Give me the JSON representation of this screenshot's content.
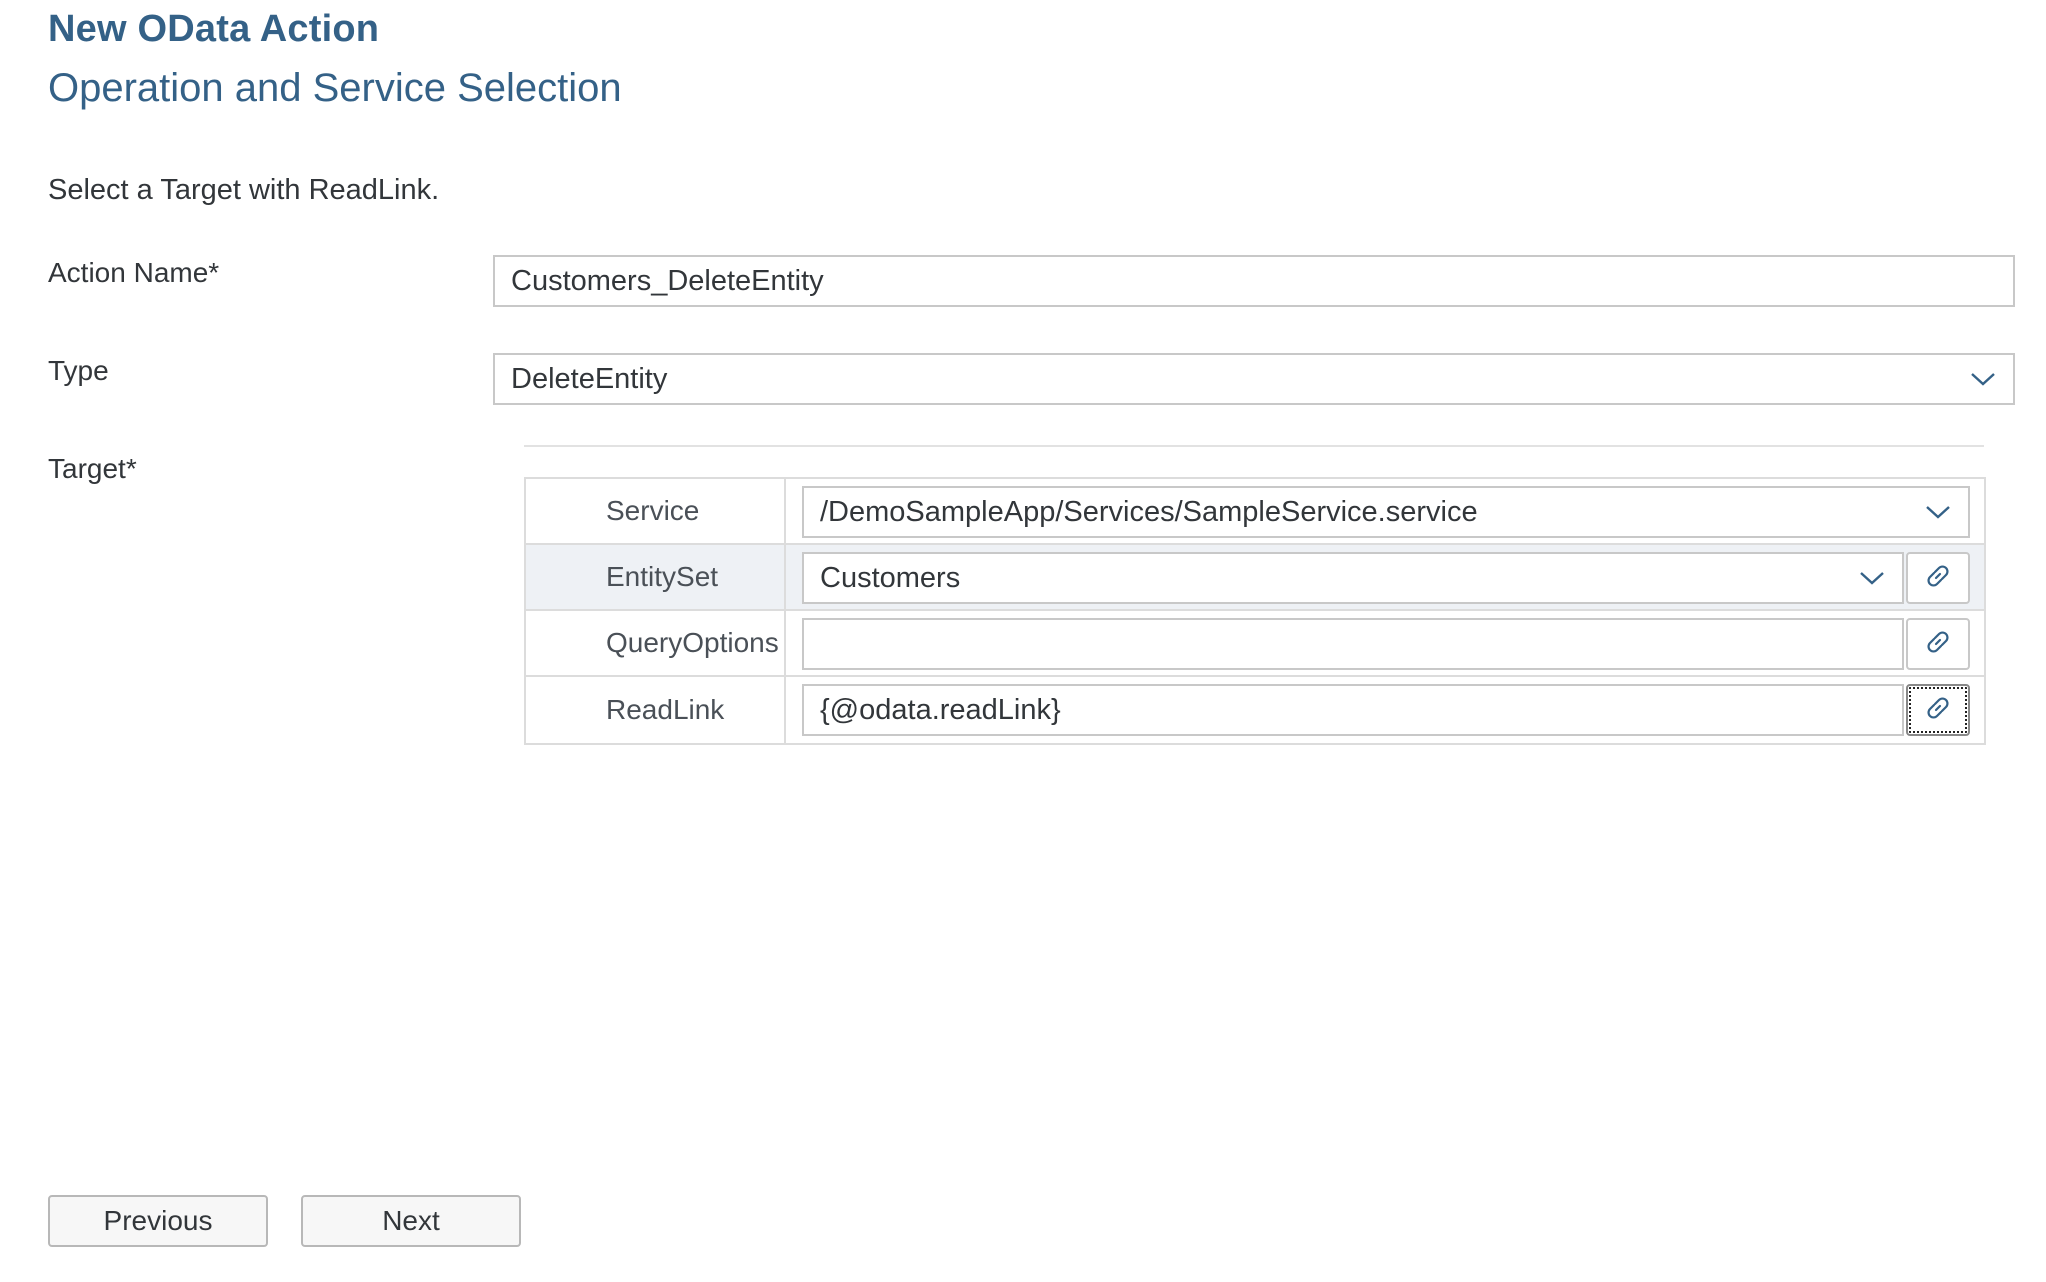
{
  "header": {
    "title": "New OData Action",
    "subtitle": "Operation and Service Selection"
  },
  "instruction": "Select a Target with ReadLink.",
  "form": {
    "action_name": {
      "label": "Action Name*",
      "value": "Customers_DeleteEntity"
    },
    "type": {
      "label": "Type",
      "value": "DeleteEntity"
    },
    "target": {
      "label": "Target*",
      "rows": [
        {
          "label": "Service",
          "value": "/DemoSampleApp/Services/SampleService.service",
          "control": "select"
        },
        {
          "label": "EntitySet",
          "value": "Customers",
          "control": "select"
        },
        {
          "label": "QueryOptions",
          "value": "",
          "control": "input"
        },
        {
          "label": "ReadLink",
          "value": "{@odata.readLink}",
          "control": "input"
        }
      ]
    }
  },
  "footer": {
    "previous_label": "Previous",
    "next_label": "Next"
  },
  "icons": {
    "dropdown": "chevron-down-icon",
    "binding": "link-icon"
  },
  "colors": {
    "heading": "#346187",
    "text": "#32363a",
    "border": "#c8c8c8",
    "selected_row": "#eef1f5"
  }
}
